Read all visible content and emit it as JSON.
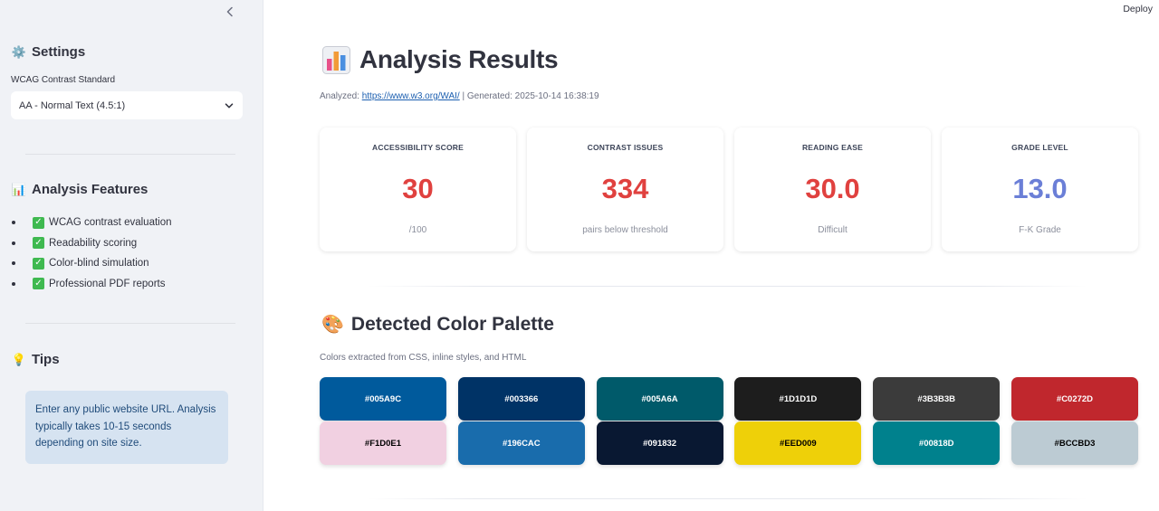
{
  "header": {
    "deploy_label": "Deploy"
  },
  "sidebar": {
    "settings_icon": "⚙️",
    "settings_title": "Settings",
    "contrast_label": "WCAG Contrast Standard",
    "contrast_selected": "AA - Normal Text (4.5:1)",
    "features_icon": "📊",
    "features_title": "Analysis Features",
    "features": [
      "WCAG contrast evaluation",
      "Readability scoring",
      "Color-blind simulation",
      "Professional PDF reports"
    ],
    "tips_icon": "💡",
    "tips_title": "Tips",
    "tip_text": "Enter any public website URL. Analysis typically takes 10-15 seconds depending on site size."
  },
  "main": {
    "title": "Analysis Results",
    "analyzed_label": "Analyzed: ",
    "analyzed_url": "https://www.w3.org/WAI/",
    "generated_text": " | Generated: 2025-10-14 16:38:19",
    "metrics": [
      {
        "label": "ACCESSIBILITY SCORE",
        "value": "30",
        "sub": "/100",
        "color": "#e0413f"
      },
      {
        "label": "CONTRAST ISSUES",
        "value": "334",
        "sub": "pairs below threshold",
        "color": "#e0413f"
      },
      {
        "label": "READING EASE",
        "value": "30.0",
        "sub": "Difficult",
        "color": "#e0413f"
      },
      {
        "label": "GRADE LEVEL",
        "value": "13.0",
        "sub": "F-K Grade",
        "color": "#6b7fd7"
      }
    ],
    "palette_icon": "🎨",
    "palette_title": "Detected Color Palette",
    "palette_subtitle": "Colors extracted from CSS, inline styles, and HTML",
    "palette": [
      {
        "hex": "#005A9C",
        "text_color": "#ffffff"
      },
      {
        "hex": "#003366",
        "text_color": "#ffffff"
      },
      {
        "hex": "#005A6A",
        "text_color": "#ffffff"
      },
      {
        "hex": "#1D1D1D",
        "text_color": "#ffffff"
      },
      {
        "hex": "#3B3B3B",
        "text_color": "#ffffff"
      },
      {
        "hex": "#C0272D",
        "text_color": "#ffffff"
      },
      {
        "hex": "#F1D0E1",
        "text_color": "#000000"
      },
      {
        "hex": "#196CAC",
        "text_color": "#ffffff"
      },
      {
        "hex": "#091832",
        "text_color": "#ffffff"
      },
      {
        "hex": "#EED009",
        "text_color": "#000000"
      },
      {
        "hex": "#00818D",
        "text_color": "#ffffff"
      },
      {
        "hex": "#BCCBD3",
        "text_color": "#000000"
      }
    ]
  }
}
